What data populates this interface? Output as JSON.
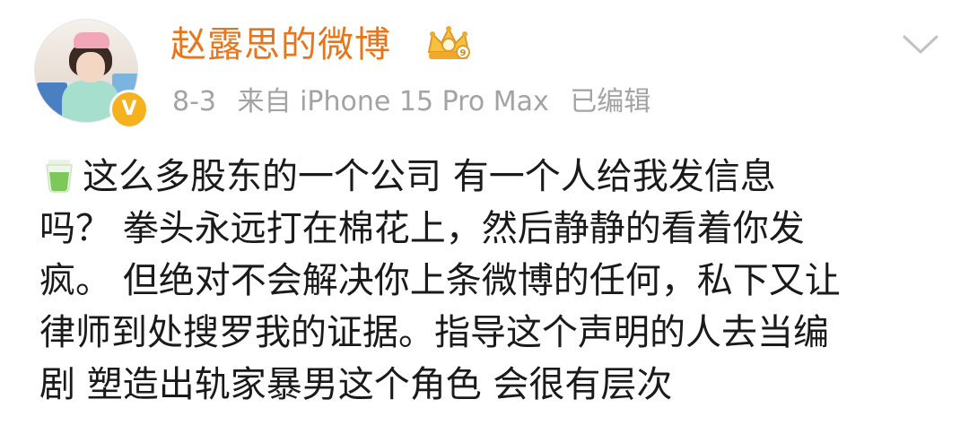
{
  "header": {
    "username": "赵露思的微博",
    "date": "8-3",
    "source": "来自 iPhone 15 Pro Max",
    "edited": "已编辑",
    "verified_badge_letter": "V",
    "username_color": "#e8751a"
  },
  "post": {
    "lines": [
      "这么多股东的一个公司 有一个人给我发信息",
      "吗？ 拳头永远打在棉花上，然后静静的看着你发",
      "疯。 但绝对不会解决你上条微博的任何，私下又让",
      "律师到处搜罗我的证据。指导这个声明的人去当编",
      "剧 塑造出轨家暴男这个角色 会很有层次"
    ],
    "leading_icon": "tea-cup-icon"
  },
  "icons": {
    "crown": "gold-crown-badge-icon",
    "chevron": "chevron-down-icon",
    "verified": "orange-verified-badge-icon"
  }
}
